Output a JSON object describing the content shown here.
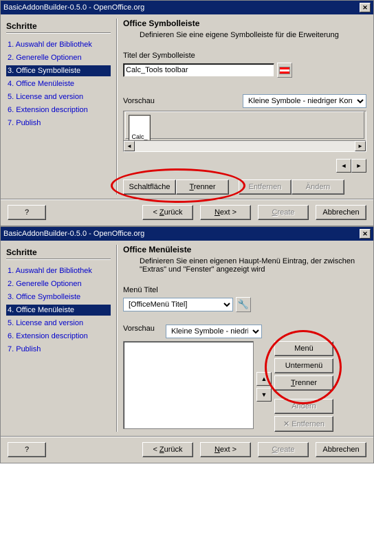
{
  "dialog1": {
    "title": "BasicAddonBuilder-0.5.0 - OpenOffice.org",
    "sidebarTitle": "Schritte",
    "steps": [
      "1. Auswahl der Bibliothek",
      "2. Generelle Optionen",
      "3. Office Symbolleiste",
      "4. Office Menüleiste",
      "5. License and version",
      "6. Extension description",
      "7. Publish"
    ],
    "activeStep": 2,
    "mainTitle": "Office Symbolleiste",
    "mainDesc": "Definieren Sie eine eigene Symbolleiste für die Erweiterung",
    "titelLabel": "Titel der Symbolleiste",
    "titelValue": "Calc_Tools toolbar",
    "vorschauLabel": "Vorschau",
    "iconSizeValue": "Kleine Symbole - niedriger Kontrast",
    "previewItem": "Calc_",
    "btnSchaltflaeche": "Schaltfläche",
    "btnTrenner": "Trenner",
    "btnEntfernen": "Entfernen",
    "btnAendern": "Ändern",
    "footer": {
      "help": "?",
      "back": "< Zurück",
      "next": "Next >",
      "create": "Create",
      "cancel": "Abbrechen"
    }
  },
  "dialog2": {
    "title": "BasicAddonBuilder-0.5.0 - OpenOffice.org",
    "sidebarTitle": "Schritte",
    "steps": [
      "1. Auswahl der Bibliothek",
      "2. Generelle Optionen",
      "3. Office Symbolleiste",
      "4. Office Menüleiste",
      "5. License and version",
      "6. Extension description",
      "7. Publish"
    ],
    "activeStep": 3,
    "mainTitle": "Office Menüleiste",
    "mainDesc": "Definieren Sie einen eigenen Haupt-Menü Eintrag, der zwischen \"Extras\" und \"Fenster\" angezeigt wird",
    "menuTitelLabel": "Menü Titel",
    "menuTitelValue": "[OfficeMenü Titel]",
    "vorschauLabel": "Vorschau",
    "iconSizeValue": "Kleine Symbole - niedriger Kontrast",
    "btnMenue": "Menü",
    "btnUntermenue": "Untermenü",
    "btnTrenner": "Trenner",
    "btnAendern": "Ändern",
    "btnEntfernen": "Entfernen",
    "footer": {
      "help": "?",
      "back": "< Zurück",
      "next": "Next >",
      "create": "Create",
      "cancel": "Abbrechen"
    }
  }
}
